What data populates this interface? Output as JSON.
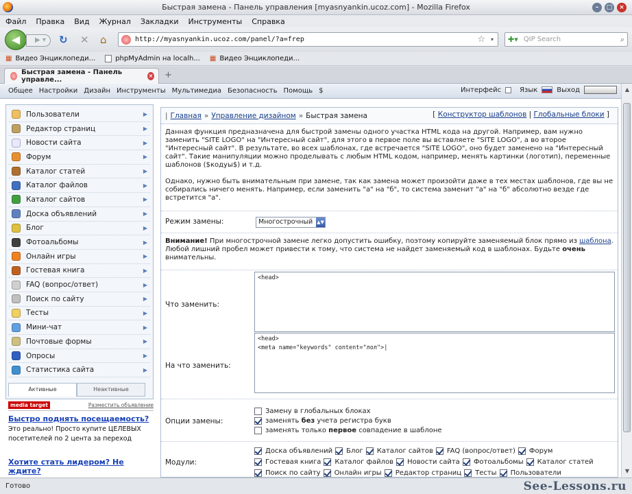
{
  "window": {
    "title": "Быстрая замена - Панель управления [myasnyankin.ucoz.com] - Mozilla Firefox"
  },
  "menubar": [
    "Файл",
    "Правка",
    "Вид",
    "Журнал",
    "Закладки",
    "Инструменты",
    "Справка"
  ],
  "nav": {
    "url": "http://myasnyankin.ucoz.com/panel/?a=frep",
    "search_placeholder": "QIP Search"
  },
  "bookmarks": [
    "Видео Энциклопеди...",
    "phpMyAdmin на localh...",
    "Видео Энциклопеди..."
  ],
  "tab": {
    "title": "Быстрая замена - Панель управле..."
  },
  "toppanel": {
    "items": [
      "Общее",
      "Настройки",
      "Дизайн",
      "Инструменты",
      "Мультимедиа",
      "Безопасность",
      "Помощь",
      "$"
    ],
    "interface": "Интерфейс",
    "lang": "Язык",
    "logout": "Выход"
  },
  "sidebar": {
    "items": [
      {
        "label": "Пользователи",
        "color": "#f0c060"
      },
      {
        "label": "Редактор страниц",
        "color": "#c0a060"
      },
      {
        "label": "Новости сайта",
        "color": "#e8e8ff"
      },
      {
        "label": "Форум",
        "color": "#e89030"
      },
      {
        "label": "Каталог статей",
        "color": "#b07030"
      },
      {
        "label": "Каталог файлов",
        "color": "#4070c0"
      },
      {
        "label": "Каталог сайтов",
        "color": "#40a040"
      },
      {
        "label": "Доска объявлений",
        "color": "#6080c0"
      },
      {
        "label": "Блог",
        "color": "#e0c040"
      },
      {
        "label": "Фотоальбомы",
        "color": "#404040"
      },
      {
        "label": "Онлайн игры",
        "color": "#f08020"
      },
      {
        "label": "Гостевая книга",
        "color": "#c06020"
      },
      {
        "label": "FAQ (вопрос/ответ)",
        "color": "#d0d0d0"
      },
      {
        "label": "Поиск по сайту",
        "color": "#c0c0c0"
      },
      {
        "label": "Тесты",
        "color": "#f0d060"
      },
      {
        "label": "Мини-чат",
        "color": "#60a0e0"
      },
      {
        "label": "Почтовые формы",
        "color": "#d0c080"
      },
      {
        "label": "Опросы",
        "color": "#3060c0"
      },
      {
        "label": "Статистика сайта",
        "color": "#4090d0"
      }
    ],
    "tab_active": "Активные",
    "tab_inactive": "Неактивные"
  },
  "ad": {
    "brand": "media target",
    "place": "Разместить объявление",
    "headline": "Быстро поднять посещаемость?",
    "body": "Это реально! Просто купите ЦЕЛЕВЫХ посетителей по 2 цента за переход",
    "headline2": "Хотите стать лидером? Не ждите?"
  },
  "main": {
    "breadcrumb": {
      "home": "Главная",
      "design": "Управление дизайном",
      "current": "Быстрая замена"
    },
    "right_links": {
      "builder": "Конструктор шаблонов",
      "global": "Глобальные блоки"
    },
    "intro1": "Данная функция предназначена для быстрой замены одного участка HTML кода на другой. Например, вам нужно заменить \"SITE LOGO\" на \"Интересный сайт\", для этого в первое поле вы вставляете \"SITE LOGO\", а во второе \"Интересный сайт\". В результате, во всех шаблонах, где встречается \"SITE LOGO\", оно будет заменено на \"Интересный сайт\". Такие манипуляции можно проделывать с любым HTML кодом, например, менять картинки (логотип), переменные шаблонов ($кодуы$) и т.д.",
    "intro2": "Однако, нужно быть внимательным при замене, так как замена может произойти даже в тех местах шаблонов, где вы не собирались ничего менять. Например, если заменить \"а\" на \"б\", то система заменит \"а\" на \"б\" абсолютно везде где встретится \"а\".",
    "mode_label": "Режим замены:",
    "mode_value": "Многострочный",
    "warn_bold": "Внимание!",
    "warn_text": " При многострочной замене легко допустить ошибку, поэтому копируйте заменяемый блок прямо из ",
    "warn_link": "шаблона",
    "warn_text2": ". Любой лишний пробел может привести к тому, что система не найдет заменяемый код в шаблонах. Будьте ",
    "warn_bold2": "очень",
    "warn_text3": " внимательны.",
    "find_label": "Что заменить:",
    "find_value": "<head>",
    "replace_label": "На что заменить:",
    "replace_value": "<head>\n<meta name=\"keywords\" content=\"лол\">|",
    "options_label": "Опции замены:",
    "opt1": "Замену в глобальных блоках",
    "opt2a": "заменять ",
    "opt2b": "без",
    "opt2c": " учета регистра букв",
    "opt3a": "заменять только ",
    "opt3b": "первое",
    "opt3c": " совпадение в шаблоне",
    "modules_label": "Модули:",
    "modules": [
      "Доска объявлений",
      "Блог",
      "Каталог сайтов",
      "FAQ (вопрос/ответ)",
      "Форум",
      "Гостевая книга",
      "Каталог файлов",
      "Новости сайта",
      "Фотоальбомы",
      "Каталог статей",
      "Поиск по сайту",
      "Онлайн игры",
      "Редактор страниц",
      "Тесты",
      "Пользователи"
    ]
  },
  "status": {
    "text": "Готово",
    "watermark": "See-Lessons.ru"
  }
}
